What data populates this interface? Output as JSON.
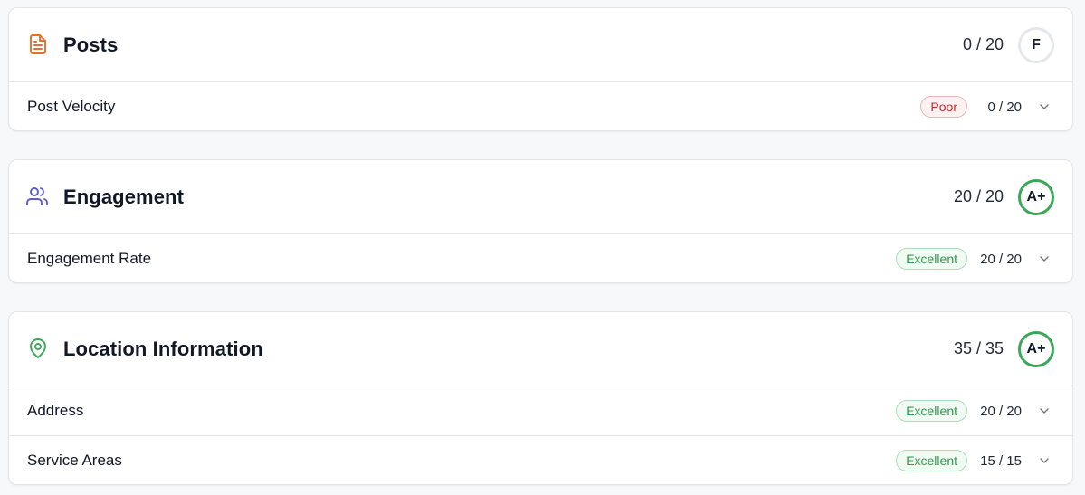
{
  "sections": [
    {
      "title": "Posts",
      "icon": "document-icon",
      "score": "0 / 20",
      "grade": "F",
      "rows": [
        {
          "label": "Post Velocity",
          "badge": "Poor",
          "score": "0 / 20"
        }
      ]
    },
    {
      "title": "Engagement",
      "icon": "users-icon",
      "score": "20 / 20",
      "grade": "A+",
      "rows": [
        {
          "label": "Engagement Rate",
          "badge": "Excellent",
          "score": "20 / 20"
        }
      ]
    },
    {
      "title": "Location Information",
      "icon": "map-pin-icon",
      "score": "35 / 35",
      "grade": "A+",
      "rows": [
        {
          "label": "Address",
          "badge": "Excellent",
          "score": "20 / 20"
        },
        {
          "label": "Service Areas",
          "badge": "Excellent",
          "score": "15 / 15"
        }
      ]
    }
  ],
  "colors": {
    "posts_icon": "#e8702a",
    "engagement_icon": "#5b5bd6",
    "location_icon": "#3aa857",
    "grade_good": "#3aa857",
    "grade_fail": "#e5e7eb",
    "poor": "#cc2b2b",
    "excellent": "#2f9a4b"
  }
}
